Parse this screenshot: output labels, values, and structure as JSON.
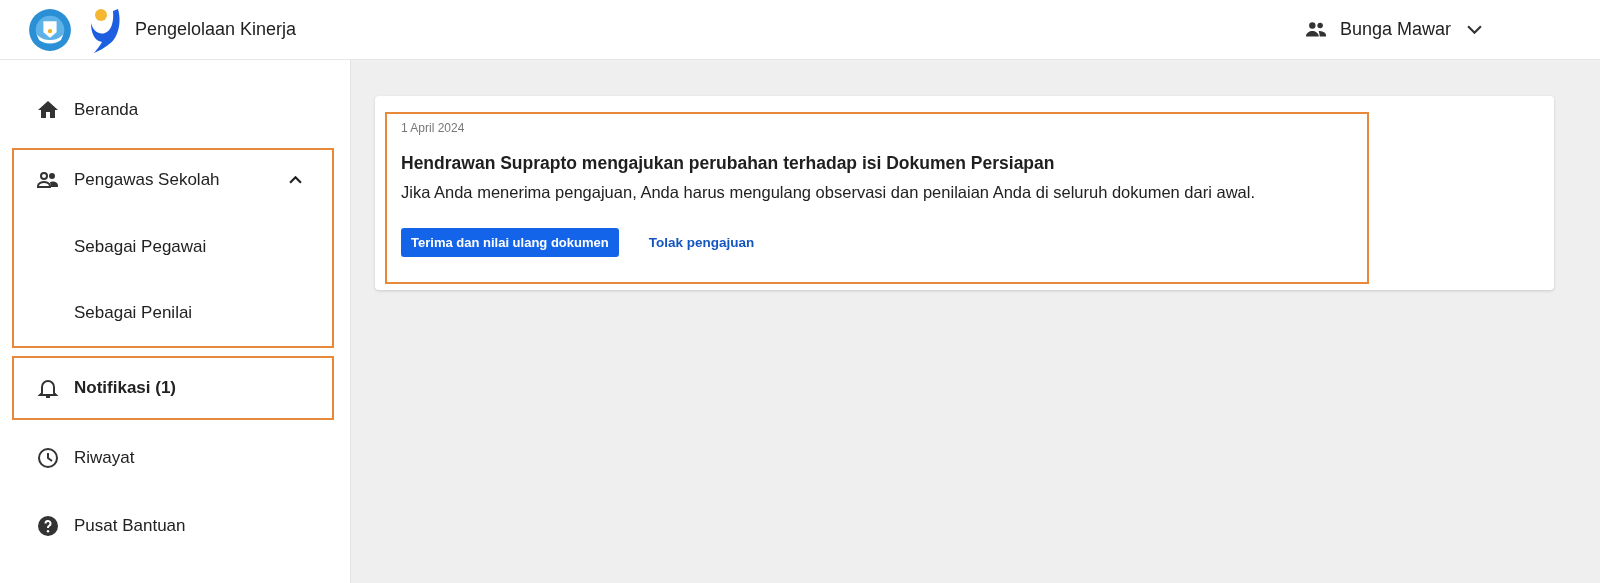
{
  "header": {
    "title": "Pengelolaan Kinerja",
    "user": {
      "name": "Bunga Mawar"
    }
  },
  "sidebar": {
    "items": [
      {
        "kind": "link",
        "label": "Beranda",
        "selected": false,
        "highlighted": false
      },
      {
        "kind": "group",
        "label": "Pengawas Sekolah",
        "selected": false,
        "highlighted": true,
        "expanded": true,
        "children": [
          {
            "label": "Sebagai Pegawai",
            "selected": false
          },
          {
            "label": "Sebagai Penilai",
            "selected": false
          }
        ]
      },
      {
        "kind": "link",
        "label": "Notifikasi (1)",
        "selected": true,
        "highlighted": true
      },
      {
        "kind": "link",
        "label": "Riwayat",
        "selected": false,
        "highlighted": false
      },
      {
        "kind": "link",
        "label": "Pusat Bantuan",
        "selected": false,
        "highlighted": false
      }
    ]
  },
  "notifications": [
    {
      "date": "1 April 2024",
      "title": "Hendrawan Suprapto mengajukan perubahan terhadap isi Dokumen Persiapan",
      "message": "Jika Anda menerima pengajuan, Anda harus mengulang observasi dan penilaian Anda di seluruh dokumen dari awal.",
      "highlighted": true,
      "accept_button": "Terima dan nilai ulang dokumen",
      "reject_link": "Tolak pengajuan"
    }
  ]
}
